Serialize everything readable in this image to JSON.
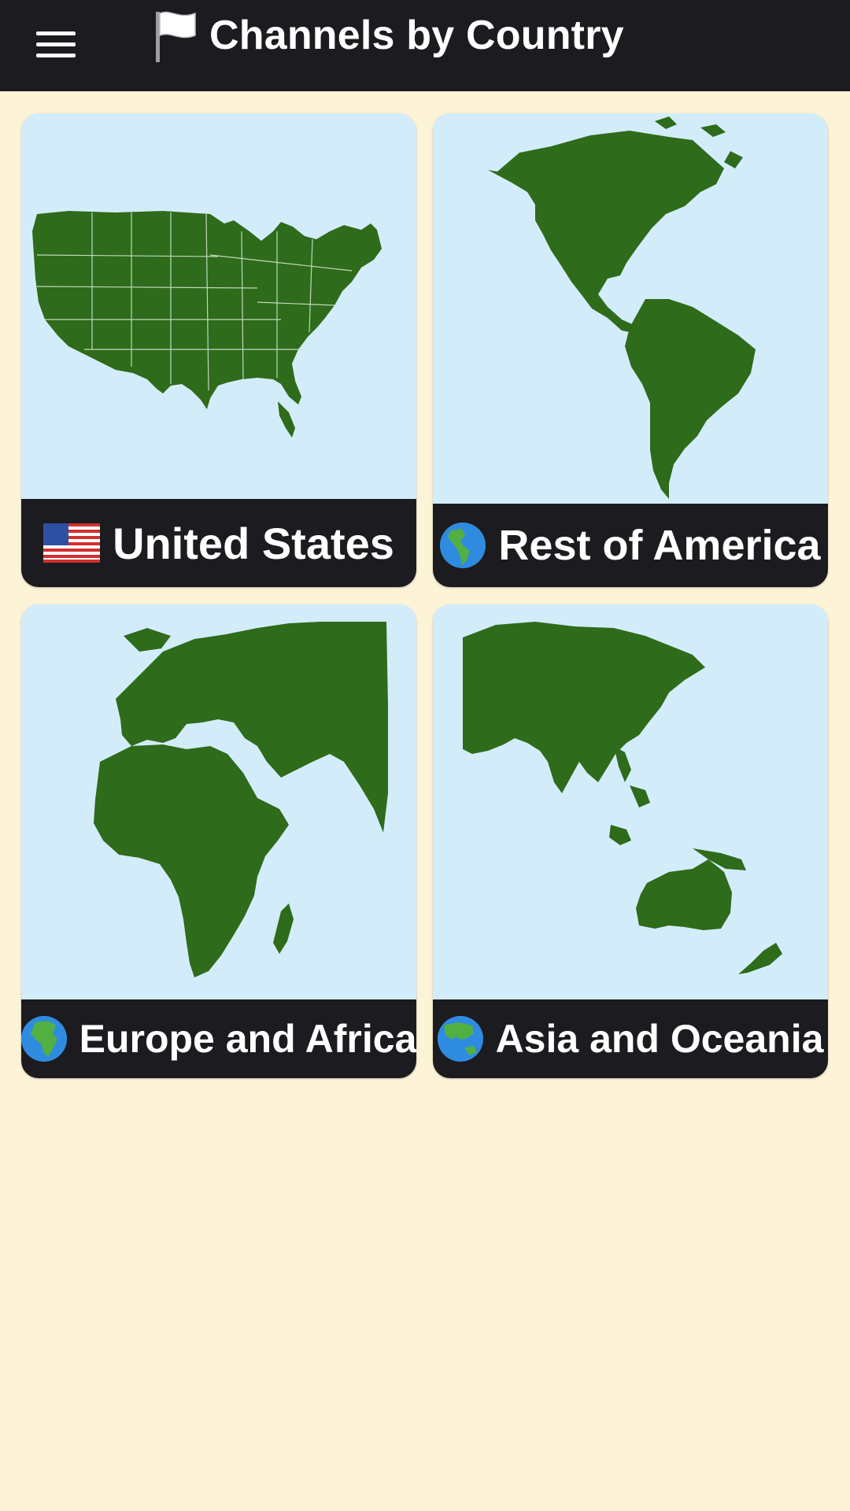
{
  "appbar": {
    "title": "Channels by Country",
    "menu_icon": "hamburger-menu-icon",
    "title_icon": "white-flag-icon"
  },
  "cards": [
    {
      "label": "United States",
      "icon": "us-flag-icon"
    },
    {
      "label": "Rest of America",
      "icon": "globe-americas-icon"
    },
    {
      "label": "Europe and Africa",
      "icon": "globe-europe-africa-icon"
    },
    {
      "label": "Asia and Oceania",
      "icon": "globe-asia-oceania-icon"
    }
  ],
  "colors": {
    "appbar": "#1c1b1f",
    "background": "#fdf3d7",
    "map_sea": "#d3ecf9",
    "land": "#2e6b1a"
  }
}
